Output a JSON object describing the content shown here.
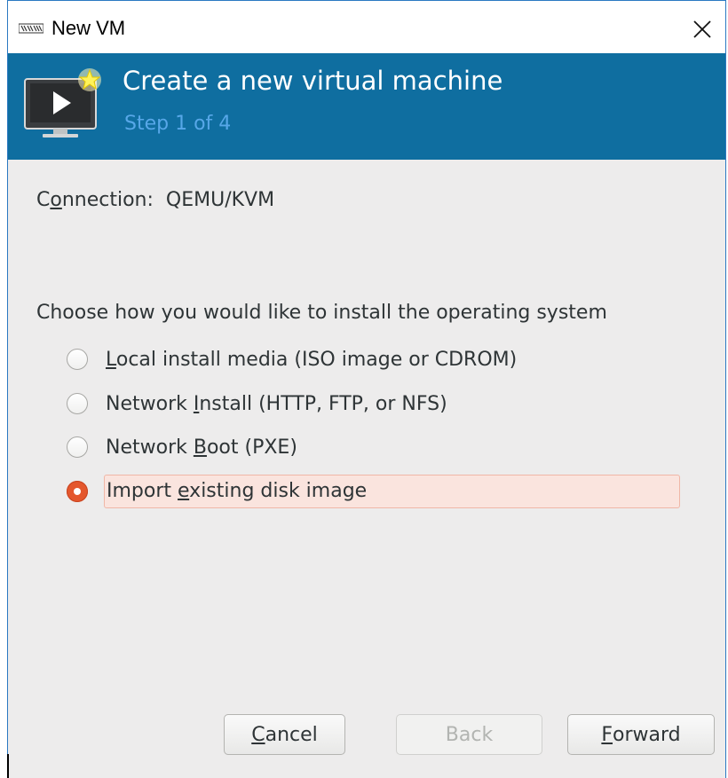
{
  "window": {
    "title": "New VM",
    "icons": {
      "app": "virt-manager-icon",
      "close": "close-icon"
    }
  },
  "banner": {
    "title": "Create a new virtual machine",
    "step": "Step 1 of 4",
    "icon": "new-vm-monitor-icon",
    "colors": {
      "background": "#0f6ea0",
      "title": "#ffffff",
      "step": "#57a7e8"
    }
  },
  "connection": {
    "label_before": "C",
    "label_mnemonic": "o",
    "label_after": "nnection:",
    "value": "QEMU/KVM"
  },
  "install": {
    "prompt": "Choose how you would like to install the operating system",
    "options": [
      {
        "before": "",
        "mnemonic": "L",
        "after": "ocal install media (ISO image or CDROM)",
        "checked": false
      },
      {
        "before": "Network ",
        "mnemonic": "I",
        "after": "nstall (HTTP, FTP, or NFS)",
        "checked": false
      },
      {
        "before": "Network ",
        "mnemonic": "B",
        "after": "oot (PXE)",
        "checked": false
      },
      {
        "before": "Import ",
        "mnemonic": "e",
        "after": "xisting disk image",
        "checked": true
      }
    ],
    "selected_index": 3,
    "accent_color": "#e4572d"
  },
  "buttons": {
    "cancel": {
      "mnemonic": "C",
      "after": "ancel",
      "enabled": true
    },
    "back": {
      "label": "Back",
      "enabled": false
    },
    "forward": {
      "mnemonic": "F",
      "after": "orward",
      "enabled": true
    }
  }
}
